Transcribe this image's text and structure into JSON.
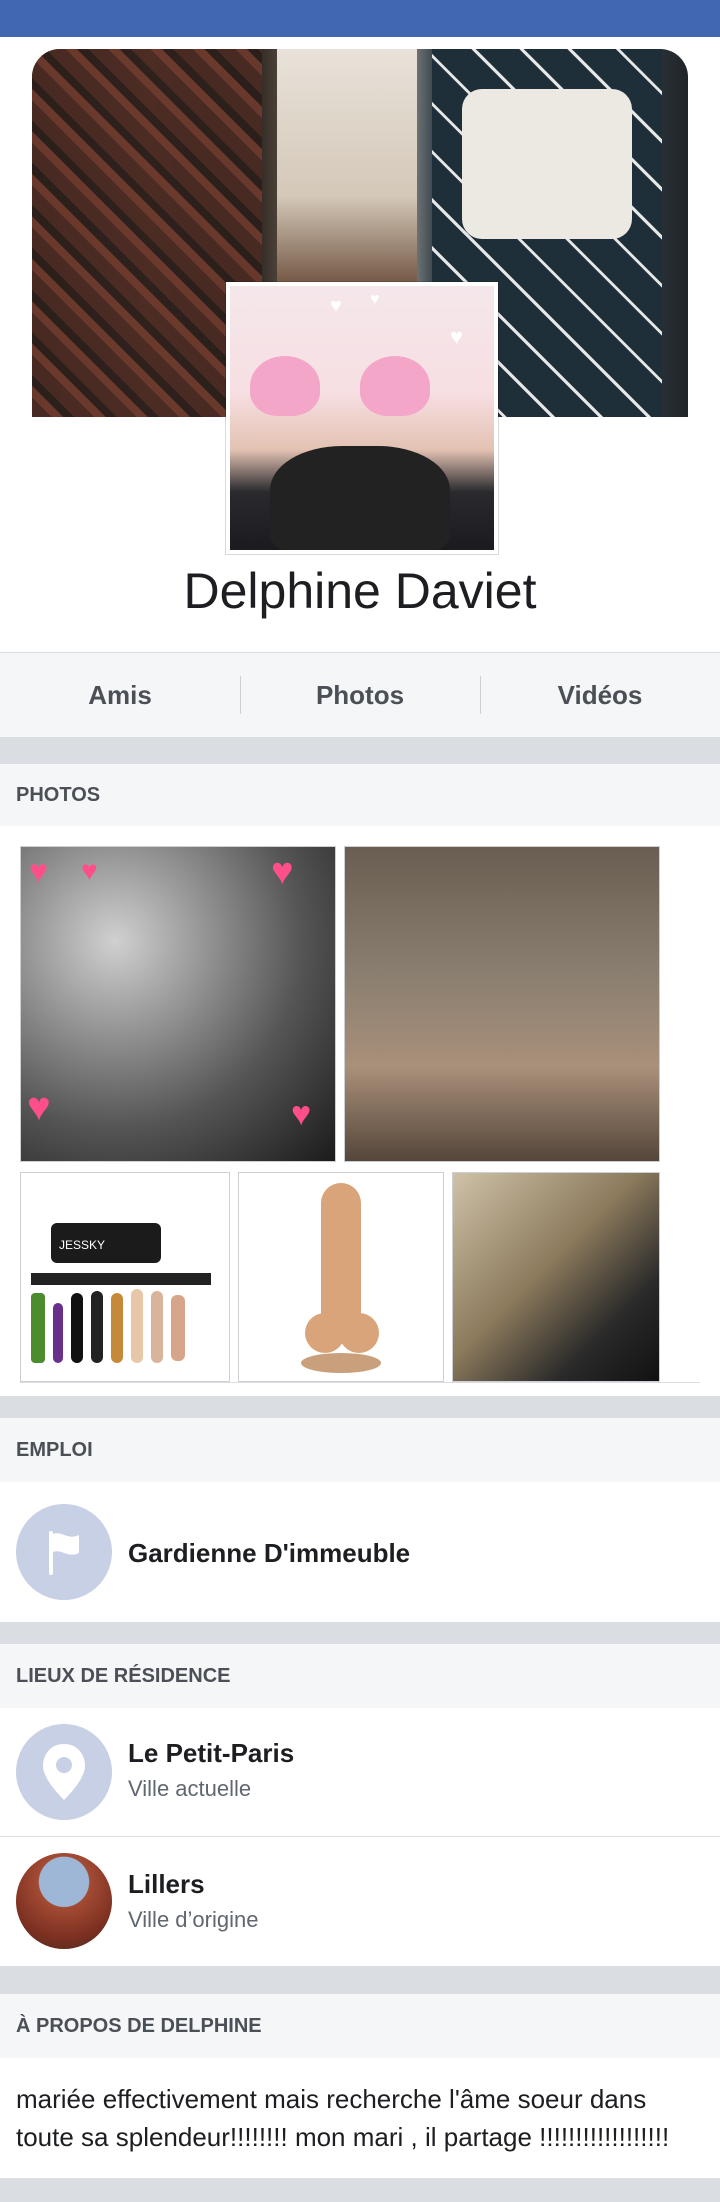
{
  "profile": {
    "name": "Delphine Daviet"
  },
  "tabs": [
    {
      "label": "Amis"
    },
    {
      "label": "Photos"
    },
    {
      "label": "Vidéos"
    }
  ],
  "sections": {
    "photos": "PHOTOS",
    "emploi": "EMPLOI",
    "residence": "LIEUX DE RÉSIDENCE",
    "about": "À PROPOS DE DELPHINE"
  },
  "work": {
    "title": "Gardienne D'immeuble",
    "icon": "flag-icon"
  },
  "places": [
    {
      "name": "Le Petit-Paris",
      "type": "Ville actuelle",
      "icon": "location-pin-icon"
    },
    {
      "name": "Lillers",
      "type": "Ville d’origine",
      "icon": "town-photo"
    }
  ],
  "about_text": "mariée effectivement mais recherche l'âme soeur dans toute sa splendeur!!!!!!!! mon mari , il partage !!!!!!!!!!!!!!!!!!",
  "photo_text": {
    "brand": "JESSKY"
  },
  "colors": {
    "topbar": "#4267b2",
    "icon_bg": "#c7d0e4"
  }
}
